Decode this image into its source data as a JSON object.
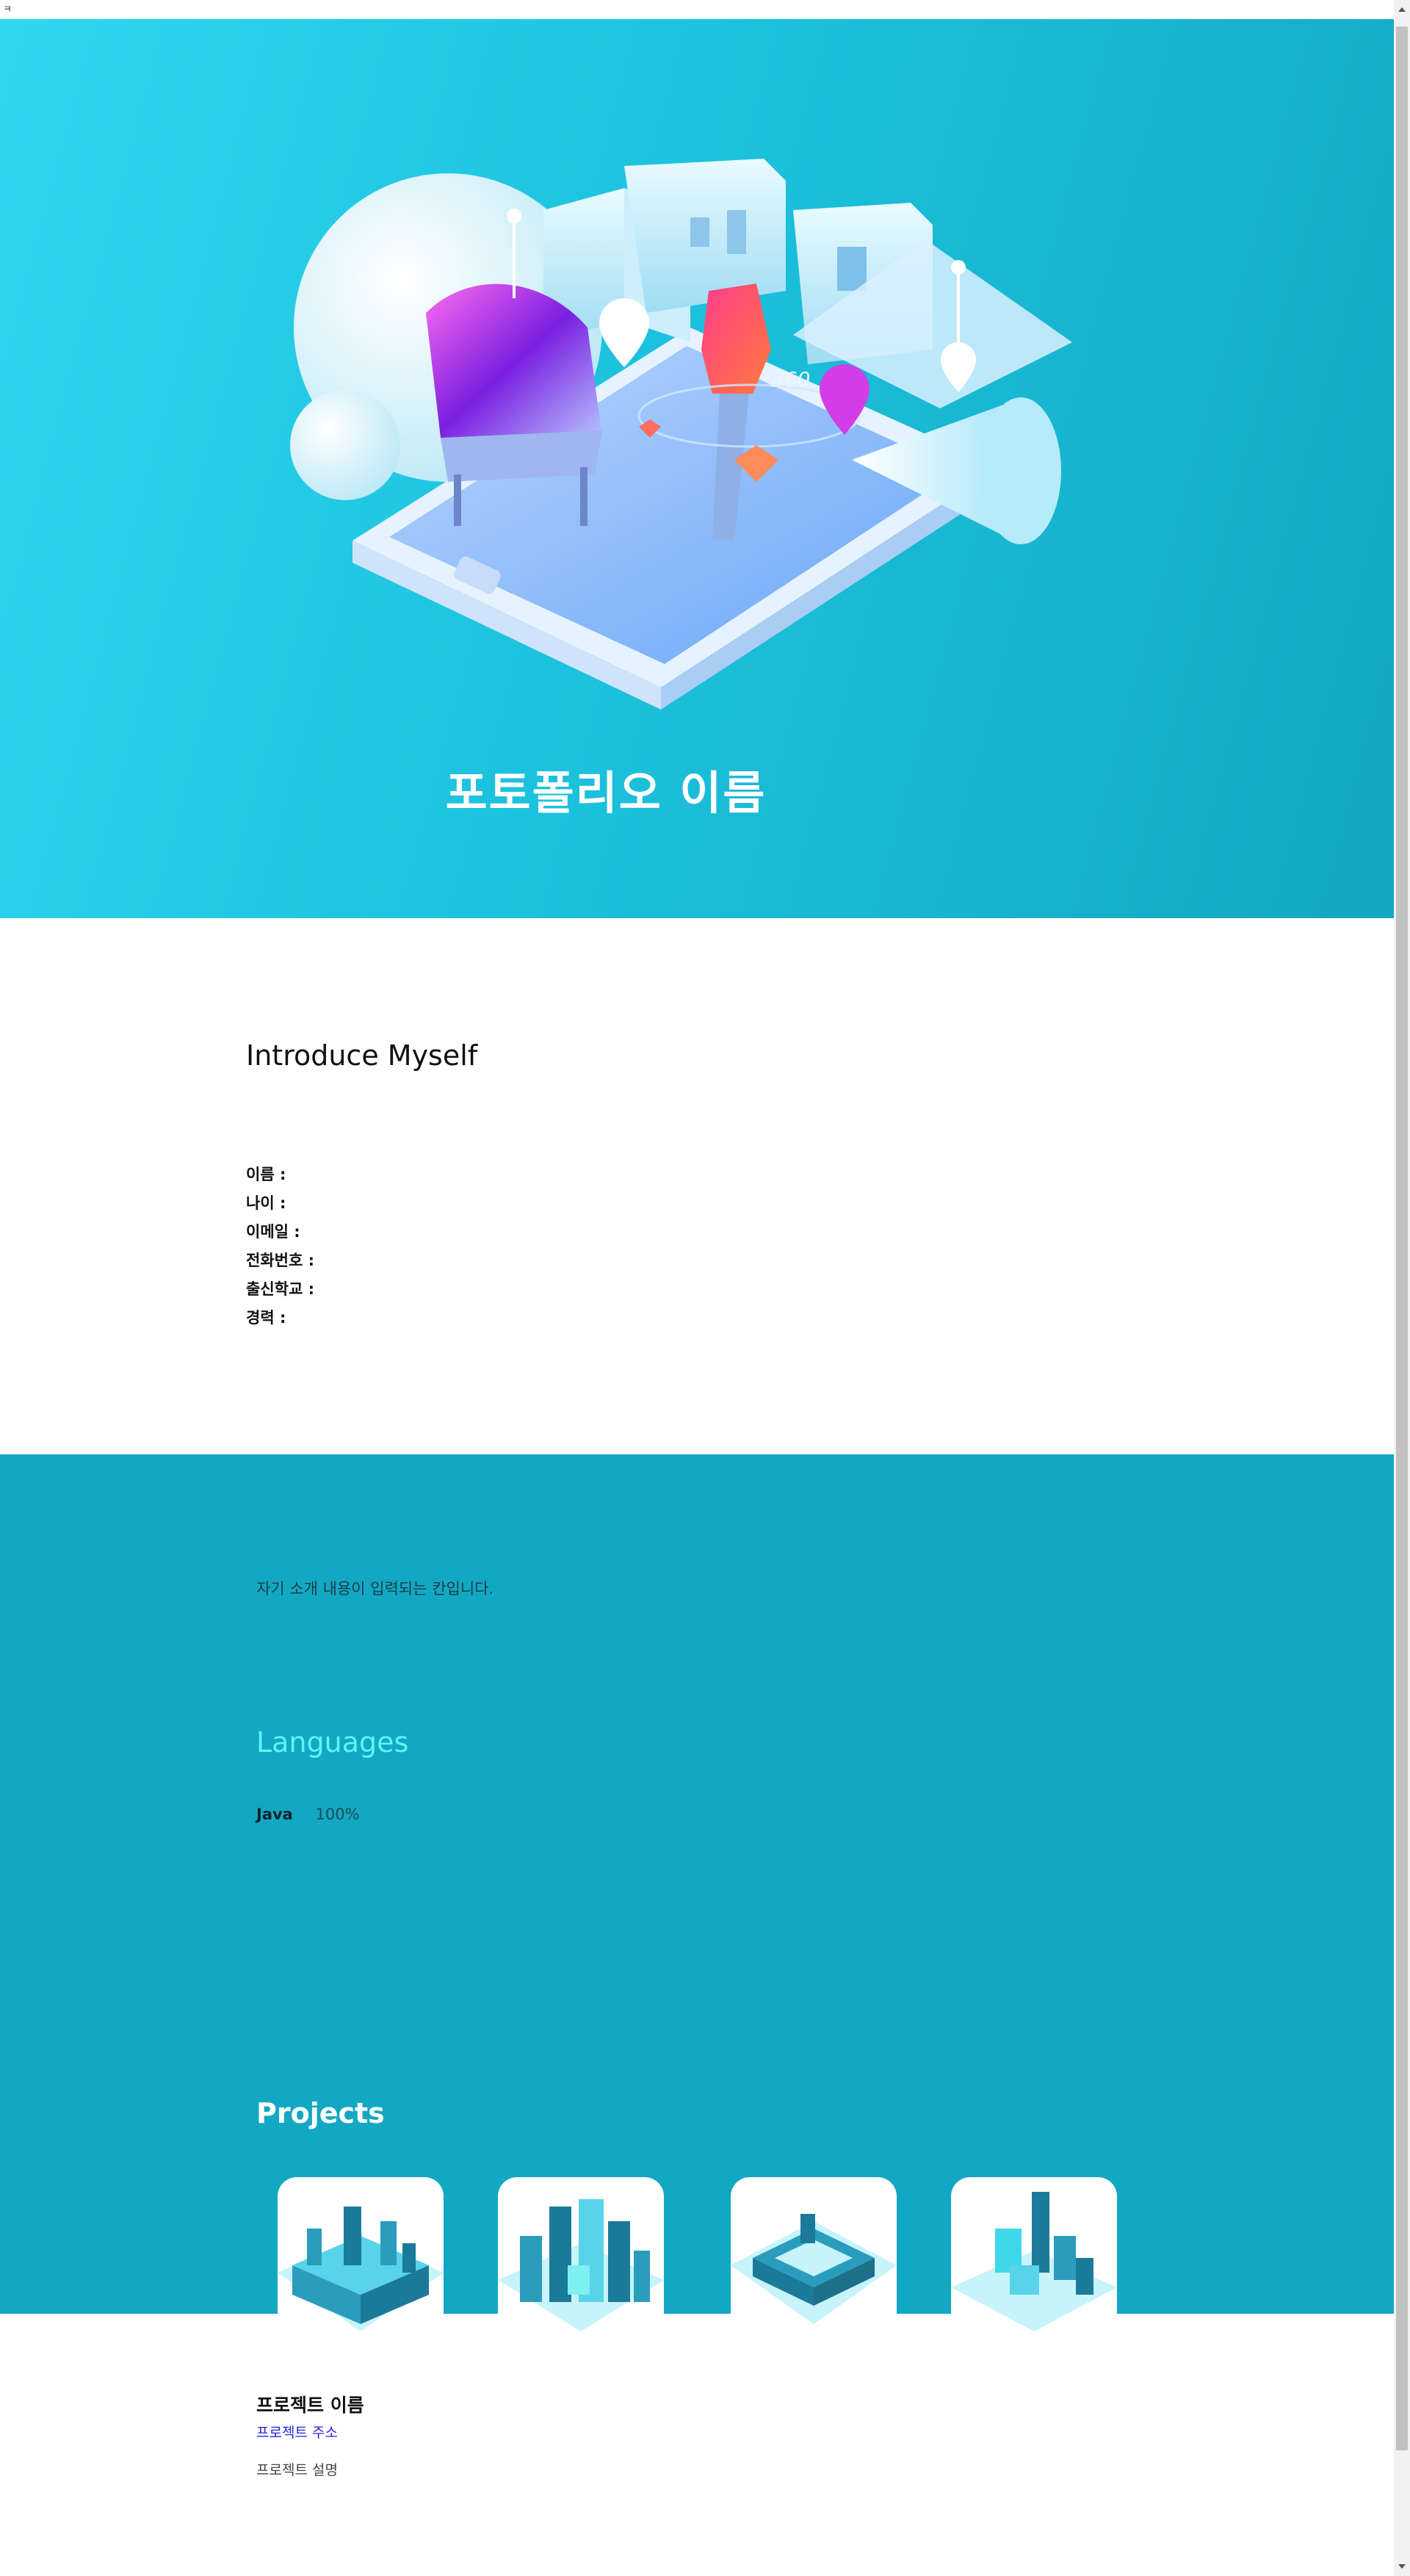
{
  "browser": {
    "corner_glyph": "ㅋ"
  },
  "hero": {
    "title": "포토폴리오 이름",
    "illustration_label": "360"
  },
  "intro": {
    "heading": "Introduce Myself",
    "fields": [
      {
        "label": "이름 :"
      },
      {
        "label": "나이 :"
      },
      {
        "label": "이메일 :"
      },
      {
        "label": "전화번호 :"
      },
      {
        "label": "출신학교 :"
      },
      {
        "label": "경력 :"
      }
    ]
  },
  "about": {
    "bio": "자기 소개 내용이 입력되는 칸입니다."
  },
  "languages": {
    "heading": "Languages",
    "items": [
      {
        "name": "Java",
        "percent": "100%"
      }
    ]
  },
  "projects": {
    "heading": "Projects",
    "card_icons": [
      "isometric-city-icon",
      "isometric-city-icon",
      "isometric-city-icon",
      "isometric-city-icon"
    ],
    "item": {
      "name": "프로젝트 이름",
      "link": "프로젝트 주소",
      "description": "프로젝트 설명"
    }
  },
  "colors": {
    "hero_start": "#2fd6f0",
    "hero_end": "#12a7c2",
    "section_teal": "#12a8c3",
    "languages_heading": "#5ff4f4",
    "link_blue": "#2626d8"
  }
}
